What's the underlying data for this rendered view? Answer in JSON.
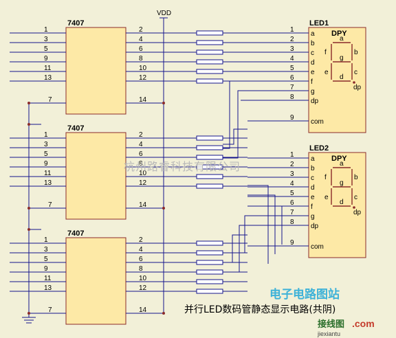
{
  "vdd_label": "VDD",
  "buffer_chip": {
    "name": "7407",
    "input_pins": [
      "1",
      "3",
      "5",
      "9",
      "11",
      "13"
    ],
    "output_pins": [
      "2",
      "4",
      "6",
      "8",
      "10",
      "12"
    ],
    "gnd_pin": "7",
    "vcc_pin": "14"
  },
  "displays": [
    {
      "name": "LED1",
      "part": "DPY",
      "pins": [
        "1",
        "2",
        "3",
        "4",
        "5",
        "6",
        "7",
        "8",
        "9"
      ],
      "pin_names": [
        "a",
        "b",
        "c",
        "d",
        "e",
        "f",
        "g",
        "dp",
        "com"
      ],
      "segments": [
        "a",
        "b",
        "c",
        "d",
        "e",
        "f",
        "g",
        "dp"
      ]
    },
    {
      "name": "LED2",
      "part": "DPY",
      "pins": [
        "1",
        "2",
        "3",
        "4",
        "5",
        "6",
        "7",
        "8",
        "9"
      ],
      "pin_names": [
        "a",
        "b",
        "c",
        "d",
        "e",
        "f",
        "g",
        "dp",
        "com"
      ],
      "segments": [
        "a",
        "b",
        "c",
        "d",
        "e",
        "f",
        "g",
        "dp"
      ]
    }
  ],
  "watermark_company": "杭州路睿科技有限公司",
  "watermark_site": "电子电路图站",
  "caption": "并行LED数码管静态显示电路(共阴)",
  "logo_text": "接线图",
  "logo_com": ".com",
  "logo_url": "jiexiantu"
}
